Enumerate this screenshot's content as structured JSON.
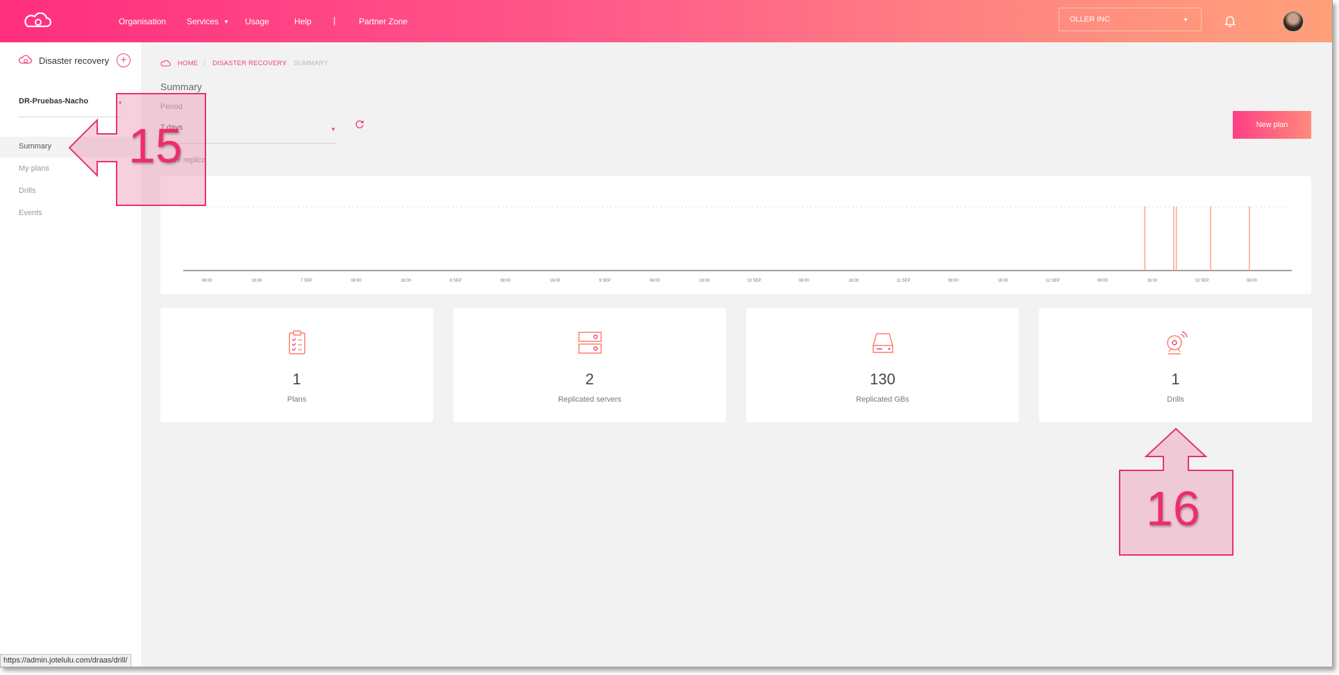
{
  "header": {
    "nav": [
      {
        "label": "Organisation"
      },
      {
        "label": "Services"
      },
      {
        "label": "Usage"
      },
      {
        "label": "Help"
      },
      {
        "label": "Partner Zone"
      }
    ],
    "separator": "|",
    "org_select": "OLLER INC",
    "logo_icon": "cloud-logo-icon",
    "bell_icon": "bell-icon"
  },
  "sidebar": {
    "title": "Disaster recovery",
    "plus": "+",
    "plan_select": "DR-Pruebas-Nacho",
    "items": [
      {
        "label": "Summary",
        "active": true
      },
      {
        "label": "My plans",
        "active": false
      },
      {
        "label": "Drills",
        "active": false
      },
      {
        "label": "Events",
        "active": false
      }
    ]
  },
  "breadcrumb": {
    "home": "HOME",
    "section": "DISASTER RECOVERY",
    "current": "SUMMARY",
    "sep": "/"
  },
  "main": {
    "title": "Summary",
    "period_label": "Period",
    "period_value": "7 days",
    "active_label": "Active replica",
    "new_plan": "New plan"
  },
  "chart_data": {
    "type": "bar",
    "title": "",
    "x_ticks": [
      "08:00",
      "16:00",
      "7 SEP",
      "08:00",
      "16:00",
      "8 SEP",
      "08:00",
      "16:00",
      "9 SEP",
      "08:00",
      "16:00",
      "10 SEP",
      "08:00",
      "16:00",
      "11 SEP",
      "08:00",
      "16:00",
      "12 SEP",
      "08:00",
      "16:00",
      "13 SEP",
      "08:00"
    ],
    "events_at_tick_fraction": [
      19.02,
      19.6,
      19.65,
      20.34,
      21.12
    ],
    "y_reference": 1
  },
  "stats": [
    {
      "value": "1",
      "label": "Plans",
      "icon": "clipboard-checklist-icon"
    },
    {
      "value": "2",
      "label": "Replicated servers",
      "icon": "server-rack-icon"
    },
    {
      "value": "130",
      "label": "Replicated GBs",
      "icon": "hard-drive-icon"
    },
    {
      "value": "1",
      "label": "Drills",
      "icon": "alarm-bell-icon"
    }
  ],
  "status_url": "https://admin.jotelulu.com/draas/drill/",
  "callouts": [
    {
      "number": "15"
    },
    {
      "number": "16"
    }
  ],
  "colors": {
    "accent": "#ee3f7a",
    "chart_bar": "#ff9f83"
  }
}
